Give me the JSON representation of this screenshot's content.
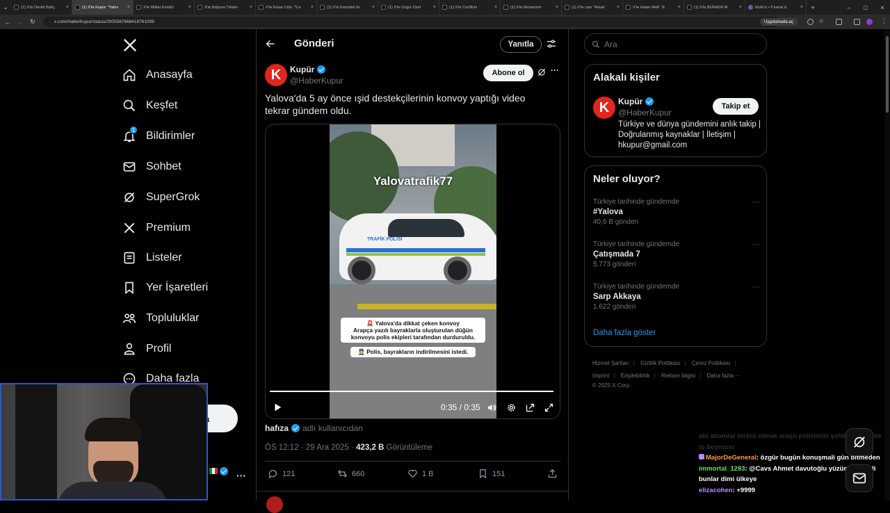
{
  "browser": {
    "tabs": [
      {
        "title": "(1) X'te Devlet Bahç",
        "active": false
      },
      {
        "title": "(1) X'te Kupür: \"Yalov",
        "active": true
      },
      {
        "title": "X'te Militer Enstitü",
        "active": false
      },
      {
        "title": "X'te Boğuna Tıklam",
        "active": false
      },
      {
        "title": "X'te Ensar Uslu: \"5 a",
        "active": false
      },
      {
        "title": "(1) X'te Emrullah Er",
        "active": false
      },
      {
        "title": "(1) X'te Özgür Özel",
        "active": false
      },
      {
        "title": "(1) X'te Conflicts",
        "active": false
      },
      {
        "title": "(1) X'te Muharrem",
        "active": false
      },
      {
        "title": "(1) X'te canı \"Arkad",
        "active": false
      },
      {
        "title": "X'te Haber Aktif: \"E",
        "active": false
      },
      {
        "title": "(1) X'te BURADA W",
        "active": false
      },
      {
        "title": "Multi tv • 5 kanal iz",
        "active": false
      }
    ],
    "url": "x.com/HaberKupur/status/2005567668418761009",
    "app_chip": "Uygulamada aç"
  },
  "nav": {
    "items": [
      {
        "label": "Anasayfa",
        "icon": "home-icon"
      },
      {
        "label": "Keşfet",
        "icon": "search-icon"
      },
      {
        "label": "Bildirimler",
        "icon": "bell-icon",
        "badge": "1"
      },
      {
        "label": "Sohbet",
        "icon": "mail-icon"
      },
      {
        "label": "SuperGrok",
        "icon": "grok-icon"
      },
      {
        "label": "Premium",
        "icon": "x-logo-icon"
      },
      {
        "label": "Listeler",
        "icon": "list-icon"
      },
      {
        "label": "Yer İşaretleri",
        "icon": "bookmark-icon"
      },
      {
        "label": "Topluluklar",
        "icon": "people-icon"
      },
      {
        "label": "Profil",
        "icon": "person-icon"
      },
      {
        "label": "Daha fazla",
        "icon": "more-circle-icon"
      }
    ],
    "post_button": "a"
  },
  "main": {
    "header_title": "Gönderi",
    "reply_button": "Yanıtla",
    "author": {
      "name": "Kupür",
      "handle": "@HaberKupur",
      "avatar_letter": "K"
    },
    "subscribe_button": "Abone ol",
    "text": "Yalova'da 5 ay önce ışid destekçilerinin konvoy yaptığı video tekrar gündem oldu.",
    "video": {
      "watermark": "Yalovatrafik77",
      "car_label": "TRAFİK POLİSİ",
      "caption1_line1": "🚨 Yalova'da dikkat çeken konvoy",
      "caption1_line2": "Arapça yazılı bayraklarla oluşturulan düğün",
      "caption1_line3": "konvoyu polis ekipleri tarafından durduruldu.",
      "caption2": "👮 Polis, bayrakların indirilmesini istedi.",
      "time": "0:35 / 0:35",
      "progress": 1.0
    },
    "note": {
      "name": "hafıza",
      "text": "adlı kullanıcıdan"
    },
    "meta": {
      "time": "ÖS 12:12 · 29 Ara 2025 · ",
      "views": "423,2 B",
      "views_label": " Görüntüleme"
    },
    "actions": {
      "replies": "121",
      "reposts": "660",
      "likes": "1 B",
      "bookmarks": "151"
    }
  },
  "right": {
    "search_placeholder": "Ara",
    "related": {
      "title": "Alakalı kişiler",
      "name": "Kupür",
      "handle": "@HaberKupur",
      "follow_button": "Takip et",
      "bio": "Türkiye ve dünya gündemini anlık takip | Doğrulanmış kaynaklar | İletişim | hkupur@gmail.com"
    },
    "trends": {
      "title": "Neler oluyor?",
      "items": [
        {
          "category": "Türkiye tarihinde gündemde",
          "name": "#Yalova",
          "count": "40,6 B gönderi"
        },
        {
          "category": "Türkiye tarihinde gündemde",
          "name": "Çatışmada 7",
          "count": "5.773 gönderi"
        },
        {
          "category": "Türkiye tarihinde gündemde",
          "name": "Sarp Akkaya",
          "count": "1.622 gönderi"
        }
      ],
      "show_more": "Daha fazla göster"
    },
    "footer": [
      "Hizmet Şartları",
      "Gizlilik Politikası",
      "Çerez Politikası",
      "Imprint",
      "Erişilebilirlik",
      "Reklam bilgisi",
      "Daha fazla ···",
      "© 2025 X Corp."
    ]
  },
  "chat": [
    {
      "user": "",
      "text": "abi adamlar terörü olmak araştı polisimizi şehit ettiler artık ip boynunu",
      "color": "#666666"
    },
    {
      "user": "MajorDeGeneral",
      "text": ": özgür bugün konuşmali gün bitmeden",
      "color": "#ff9a3c"
    },
    {
      "user": "immortal_1283",
      "text": ": @Cavs Ahmet davutoğlu yüzünden girdi bunlar dimi ülkeye",
      "color": "#5fe35f"
    },
    {
      "user": "elizacohen",
      "text": ": +9999",
      "color": "#b48cff"
    }
  ],
  "colors": {
    "accent": "#1d9bf0",
    "brand": "#e1261c",
    "background": "#000000",
    "border": "#2f3336"
  }
}
